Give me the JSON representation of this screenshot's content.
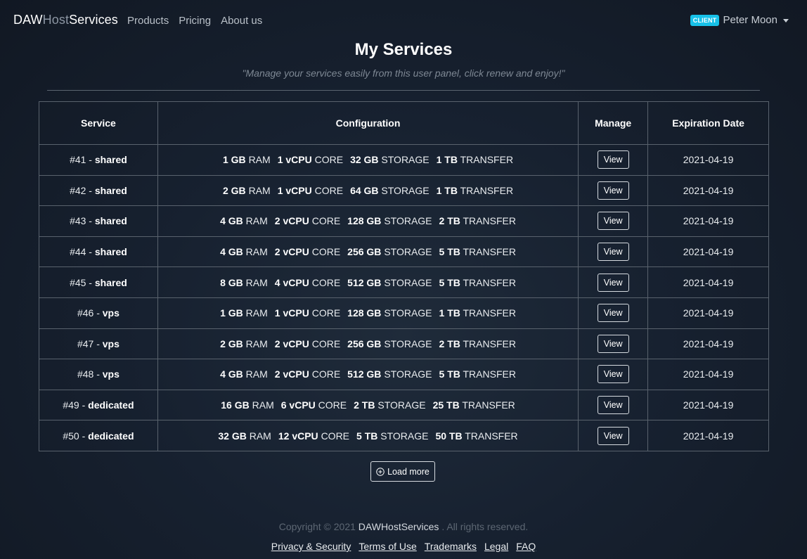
{
  "nav": {
    "brand_part1": "DAW",
    "brand_part2": "Host",
    "brand_part3": "Services",
    "links": [
      "Products",
      "Pricing",
      "About us"
    ],
    "badge": "CLIENT",
    "user_name": "Peter Moon"
  },
  "header": {
    "title": "My Services",
    "subtitle": "\"Manage your services easily from this user panel, click renew and enjoy!\""
  },
  "table": {
    "columns": [
      "Service",
      "Configuration",
      "Manage",
      "Expiration Date"
    ],
    "rows": [
      {
        "id": "#41",
        "type": "shared",
        "ram": "1 GB",
        "cpu": "1 vCPU",
        "storage": "32 GB",
        "transfer": "1 TB",
        "action": "View",
        "expires": "2021-04-19"
      },
      {
        "id": "#42",
        "type": "shared",
        "ram": "2 GB",
        "cpu": "1 vCPU",
        "storage": "64 GB",
        "transfer": "1 TB",
        "action": "View",
        "expires": "2021-04-19"
      },
      {
        "id": "#43",
        "type": "shared",
        "ram": "4 GB",
        "cpu": "2 vCPU",
        "storage": "128 GB",
        "transfer": "2 TB",
        "action": "View",
        "expires": "2021-04-19"
      },
      {
        "id": "#44",
        "type": "shared",
        "ram": "4 GB",
        "cpu": "2 vCPU",
        "storage": "256 GB",
        "transfer": "5 TB",
        "action": "View",
        "expires": "2021-04-19"
      },
      {
        "id": "#45",
        "type": "shared",
        "ram": "8 GB",
        "cpu": "4 vCPU",
        "storage": "512 GB",
        "transfer": "5 TB",
        "action": "View",
        "expires": "2021-04-19"
      },
      {
        "id": "#46",
        "type": "vps",
        "ram": "1 GB",
        "cpu": "1 vCPU",
        "storage": "128 GB",
        "transfer": "1 TB",
        "action": "View",
        "expires": "2021-04-19"
      },
      {
        "id": "#47",
        "type": "vps",
        "ram": "2 GB",
        "cpu": "2 vCPU",
        "storage": "256 GB",
        "transfer": "2 TB",
        "action": "View",
        "expires": "2021-04-19"
      },
      {
        "id": "#48",
        "type": "vps",
        "ram": "4 GB",
        "cpu": "2 vCPU",
        "storage": "512 GB",
        "transfer": "5 TB",
        "action": "View",
        "expires": "2021-04-19"
      },
      {
        "id": "#49",
        "type": "dedicated",
        "ram": "16 GB",
        "cpu": "6 vCPU",
        "storage": "2 TB",
        "transfer": "25 TB",
        "action": "View",
        "expires": "2021-04-19"
      },
      {
        "id": "#50",
        "type": "dedicated",
        "ram": "32 GB",
        "cpu": "12 vCPU",
        "storage": "5 TB",
        "transfer": "50 TB",
        "action": "View",
        "expires": "2021-04-19"
      }
    ],
    "units": {
      "ram": "RAM",
      "cpu": "CORE",
      "storage": "STORAGE",
      "transfer": "TRANSFER"
    },
    "separator": " - "
  },
  "load_more": {
    "label": "Load more",
    "icon": "plus-circle-icon"
  },
  "footer": {
    "copyright_prefix": "Copyright © 2021",
    "copyright_brand": "DAWHostServices",
    "copyright_suffix": ". All rights reserved.",
    "links": [
      "Privacy & Security",
      "Terms of Use",
      "Trademarks",
      "Legal",
      "FAQ"
    ]
  },
  "colors": {
    "badge": "#17c1e8",
    "background": "#172130",
    "border": "#59626d"
  }
}
